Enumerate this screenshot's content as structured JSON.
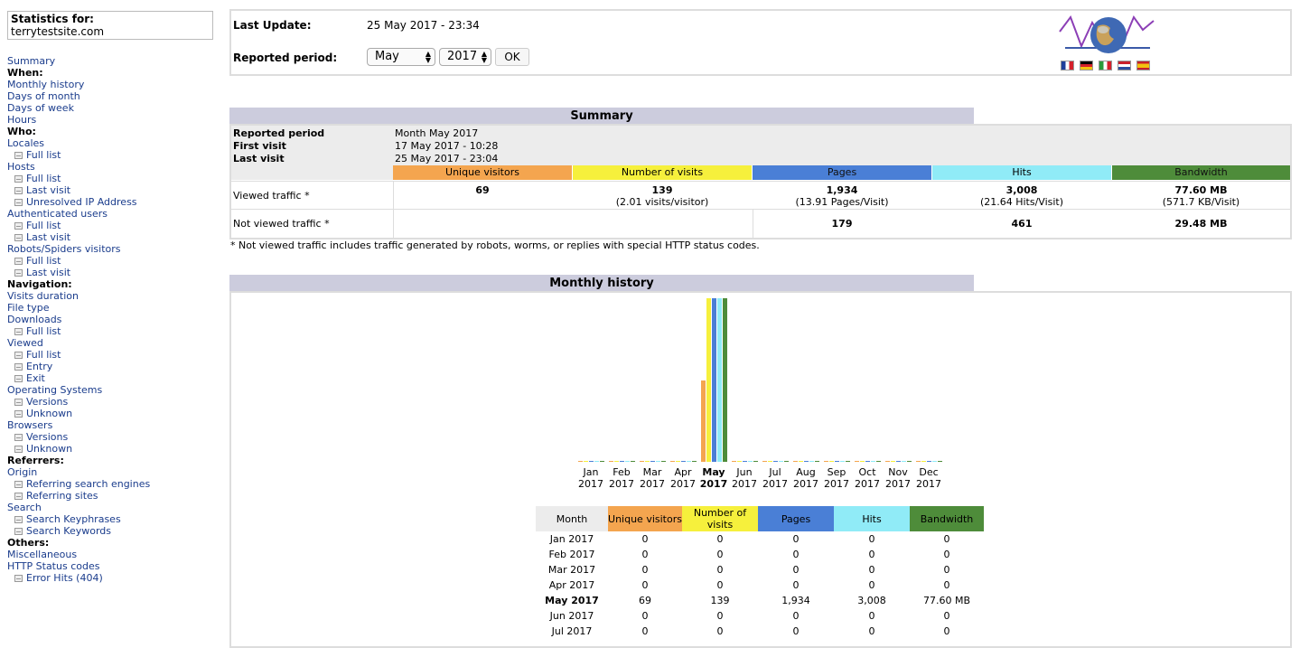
{
  "sidebar": {
    "stats_label": "Statistics for:",
    "site": "terrytestsite.com",
    "items": [
      {
        "type": "link",
        "label": "Summary"
      },
      {
        "type": "header",
        "label": "When:"
      },
      {
        "type": "link",
        "label": "Monthly history"
      },
      {
        "type": "link",
        "label": "Days of month"
      },
      {
        "type": "link",
        "label": "Days of week"
      },
      {
        "type": "link",
        "label": "Hours"
      },
      {
        "type": "header",
        "label": "Who:"
      },
      {
        "type": "link",
        "label": "Locales"
      },
      {
        "type": "sub",
        "label": "Full list"
      },
      {
        "type": "link",
        "label": "Hosts"
      },
      {
        "type": "sub",
        "label": "Full list"
      },
      {
        "type": "sub",
        "label": "Last visit"
      },
      {
        "type": "sub",
        "label": "Unresolved IP Address"
      },
      {
        "type": "link",
        "label": "Authenticated users"
      },
      {
        "type": "sub",
        "label": "Full list"
      },
      {
        "type": "sub",
        "label": "Last visit"
      },
      {
        "type": "link",
        "label": "Robots/Spiders visitors"
      },
      {
        "type": "sub",
        "label": "Full list"
      },
      {
        "type": "sub",
        "label": "Last visit"
      },
      {
        "type": "header",
        "label": "Navigation:"
      },
      {
        "type": "link",
        "label": "Visits duration"
      },
      {
        "type": "link",
        "label": "File type"
      },
      {
        "type": "link",
        "label": "Downloads"
      },
      {
        "type": "sub",
        "label": "Full list"
      },
      {
        "type": "link",
        "label": "Viewed"
      },
      {
        "type": "sub",
        "label": "Full list"
      },
      {
        "type": "sub",
        "label": "Entry"
      },
      {
        "type": "sub",
        "label": "Exit"
      },
      {
        "type": "link",
        "label": "Operating Systems"
      },
      {
        "type": "sub",
        "label": "Versions"
      },
      {
        "type": "sub",
        "label": "Unknown"
      },
      {
        "type": "link",
        "label": "Browsers"
      },
      {
        "type": "sub",
        "label": "Versions"
      },
      {
        "type": "sub",
        "label": "Unknown"
      },
      {
        "type": "header",
        "label": "Referrers:"
      },
      {
        "type": "link",
        "label": "Origin"
      },
      {
        "type": "sub",
        "label": "Referring search engines"
      },
      {
        "type": "sub",
        "label": "Referring sites"
      },
      {
        "type": "link",
        "label": "Search"
      },
      {
        "type": "sub",
        "label": "Search Keyphrases"
      },
      {
        "type": "sub",
        "label": "Search Keywords"
      },
      {
        "type": "header",
        "label": "Others:"
      },
      {
        "type": "link",
        "label": "Miscellaneous"
      },
      {
        "type": "link",
        "label": "HTTP Status codes"
      },
      {
        "type": "sub",
        "label": "Error Hits (404)"
      }
    ]
  },
  "top": {
    "last_update_label": "Last Update:",
    "last_update_value": "25 May 2017 - 23:34",
    "period_label": "Reported period:",
    "month_select": "May",
    "year_select": "2017",
    "ok_label": "OK"
  },
  "summary": {
    "title": "Summary",
    "reported_period_label": "Reported period",
    "reported_period_value": "Month May 2017",
    "first_visit_label": "First visit",
    "first_visit_value": "17 May 2017 - 10:28",
    "last_visit_label": "Last visit",
    "last_visit_value": "25 May 2017 - 23:04",
    "columns": [
      "Unique visitors",
      "Number of visits",
      "Pages",
      "Hits",
      "Bandwidth"
    ],
    "viewed_label": "Viewed traffic *",
    "viewed": [
      {
        "main": "69",
        "sub": ""
      },
      {
        "main": "139",
        "sub": "(2.01 visits/visitor)"
      },
      {
        "main": "1,934",
        "sub": "(13.91 Pages/Visit)"
      },
      {
        "main": "3,008",
        "sub": "(21.64 Hits/Visit)"
      },
      {
        "main": "77.60 MB",
        "sub": "(571.7 KB/Visit)"
      }
    ],
    "not_viewed_label": "Not viewed traffic *",
    "not_viewed": [
      "",
      "",
      "179",
      "461",
      "29.48 MB"
    ],
    "footnote": "* Not viewed traffic includes traffic generated by robots, worms, or replies with special HTTP status codes."
  },
  "history": {
    "title": "Monthly history",
    "columns": [
      "Month",
      "Unique visitors",
      "Number of visits",
      "Pages",
      "Hits",
      "Bandwidth"
    ]
  },
  "colors": {
    "visitors": "#f4a54f",
    "visits": "#f6f03c",
    "pages": "#4a7fd6",
    "hits": "#90ebf7",
    "bandwidth": "#4e8c3a",
    "section": "#ccccdd"
  },
  "chart_data": {
    "type": "bar",
    "categories": [
      "Jan 2017",
      "Feb 2017",
      "Mar 2017",
      "Apr 2017",
      "May 2017",
      "Jun 2017",
      "Jul 2017",
      "Aug 2017",
      "Sep 2017",
      "Oct 2017",
      "Nov 2017",
      "Dec 2017"
    ],
    "series": [
      {
        "name": "Unique visitors",
        "values": [
          0,
          0,
          0,
          0,
          69,
          0,
          0,
          0,
          0,
          0,
          0,
          0
        ]
      },
      {
        "name": "Number of visits",
        "values": [
          0,
          0,
          0,
          0,
          139,
          0,
          0,
          0,
          0,
          0,
          0,
          0
        ]
      },
      {
        "name": "Pages",
        "values": [
          0,
          0,
          0,
          0,
          1934,
          0,
          0,
          0,
          0,
          0,
          0,
          0
        ]
      },
      {
        "name": "Hits",
        "values": [
          0,
          0,
          0,
          0,
          3008,
          0,
          0,
          0,
          0,
          0,
          0,
          0
        ]
      },
      {
        "name": "Bandwidth",
        "values": [
          0,
          0,
          0,
          0,
          77.6,
          0,
          0,
          0,
          0,
          0,
          0,
          0
        ]
      }
    ],
    "month_labels": [
      "Jan",
      "Feb",
      "Mar",
      "Apr",
      "May",
      "Jun",
      "Jul",
      "Aug",
      "Sep",
      "Oct",
      "Nov",
      "Dec"
    ],
    "year_label": "2017",
    "current_month": "May"
  },
  "table": {
    "rows": [
      {
        "month": "Jan 2017",
        "visitors": "0",
        "visits": "0",
        "pages": "0",
        "hits": "0",
        "bandwidth": "0",
        "current": false
      },
      {
        "month": "Feb 2017",
        "visitors": "0",
        "visits": "0",
        "pages": "0",
        "hits": "0",
        "bandwidth": "0",
        "current": false
      },
      {
        "month": "Mar 2017",
        "visitors": "0",
        "visits": "0",
        "pages": "0",
        "hits": "0",
        "bandwidth": "0",
        "current": false
      },
      {
        "month": "Apr 2017",
        "visitors": "0",
        "visits": "0",
        "pages": "0",
        "hits": "0",
        "bandwidth": "0",
        "current": false
      },
      {
        "month": "May 2017",
        "visitors": "69",
        "visits": "139",
        "pages": "1,934",
        "hits": "3,008",
        "bandwidth": "77.60 MB",
        "current": true
      },
      {
        "month": "Jun 2017",
        "visitors": "0",
        "visits": "0",
        "pages": "0",
        "hits": "0",
        "bandwidth": "0",
        "current": false
      },
      {
        "month": "Jul 2017",
        "visitors": "0",
        "visits": "0",
        "pages": "0",
        "hits": "0",
        "bandwidth": "0",
        "current": false
      }
    ]
  }
}
